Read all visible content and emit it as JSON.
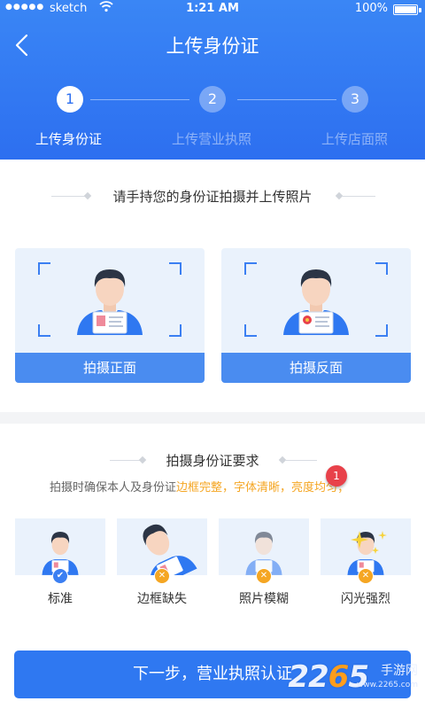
{
  "status_bar": {
    "signal": "●●●●●",
    "carrier": "sketch",
    "time": "1:21 AM",
    "battery": "100%"
  },
  "nav": {
    "title": "上传身份证"
  },
  "steps": [
    {
      "number": "1",
      "label": "上传身份证",
      "active": true
    },
    {
      "number": "2",
      "label": "上传营业执照",
      "active": false
    },
    {
      "number": "3",
      "label": "上传店面照",
      "active": false
    }
  ],
  "instruction": "请手持您的身份证拍摄并上传照片",
  "capture": {
    "front_label": "拍摄正面",
    "back_label": "拍摄反面"
  },
  "requirements": {
    "title": "拍摄身份证要求",
    "text_prefix": "拍摄时确保本人及身份证",
    "text_highlight": "边框完整，字体清晰，亮度均匀；",
    "badge_count": "1",
    "examples": [
      {
        "label": "标准",
        "status": "ok"
      },
      {
        "label": "边框缺失",
        "status": "bad"
      },
      {
        "label": "照片模糊",
        "status": "bad"
      },
      {
        "label": "闪光强烈",
        "status": "bad"
      }
    ]
  },
  "next_button": "下一步，营业执照认证",
  "watermark": {
    "number_prefix": "22",
    "number_accent": "6",
    "number_suffix": "5",
    "cn": "手游网",
    "url": "www.2265.com"
  },
  "colors": {
    "primary": "#2f78f1",
    "highlight": "#f5a623",
    "badge": "#e8414a"
  }
}
